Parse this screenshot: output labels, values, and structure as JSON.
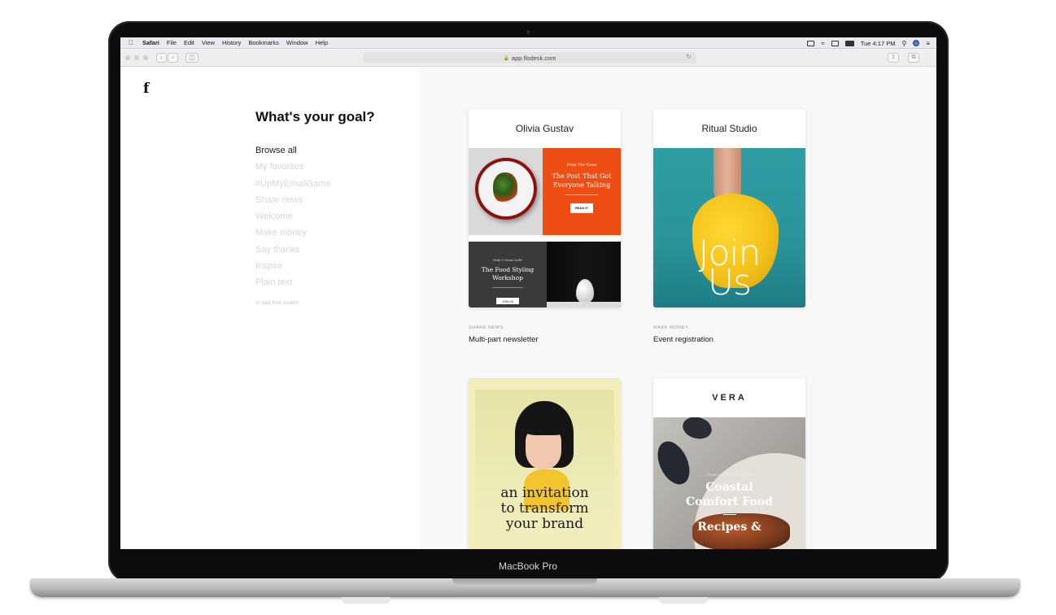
{
  "device": {
    "label": "MacBook Pro"
  },
  "menubar": {
    "app": "Safari",
    "items": [
      "File",
      "Edit",
      "View",
      "History",
      "Bookmarks",
      "Window",
      "Help"
    ],
    "clock": "Tue 4:17 PM"
  },
  "browser": {
    "url": "app.flodesk.com"
  },
  "sidebar": {
    "logo": "f",
    "title": "What's your goal?",
    "categories": [
      "Browse all",
      "My favorites",
      "#UpMyEmailGame",
      "Share news",
      "Welcome",
      "Make money",
      "Say thanks",
      "Inspire",
      "Plain text"
    ],
    "scratch_link": "or start from scratch"
  },
  "templates": [
    {
      "brand": "Olivia Gustav",
      "category": "SHARE NEWS",
      "title": "Multi-part newsletter",
      "promo_kicker": "From The Views",
      "promo_headline_1": "The Post That Got",
      "promo_headline_2": "Everyone Talking",
      "promo_button": "READ IT",
      "workshop_kicker": "Only 3 Seats Left!",
      "workshop_title_1": "The Food Styling",
      "workshop_title_2": "Workshop",
      "workshop_button": "JOIN US"
    },
    {
      "brand": "Ritual Studio",
      "category": "MAKE MONEY",
      "title": "Event registration",
      "hero_line_1": "Join",
      "hero_line_2": "Us"
    },
    {
      "headline_1": "an invitation",
      "headline_2": "to transform",
      "headline_3": "your brand"
    },
    {
      "brand": "VERA",
      "kicker": "FEATURED THIS WEEK",
      "headline_1": "Coastal",
      "headline_2": "Comfort Food",
      "headline_3": "Recipes &"
    }
  ],
  "colors": {
    "accent_orange": "#ee4e14",
    "teal": "#2a9aa0",
    "yellow": "#f2c21b",
    "cream": "#f3eeb9"
  }
}
